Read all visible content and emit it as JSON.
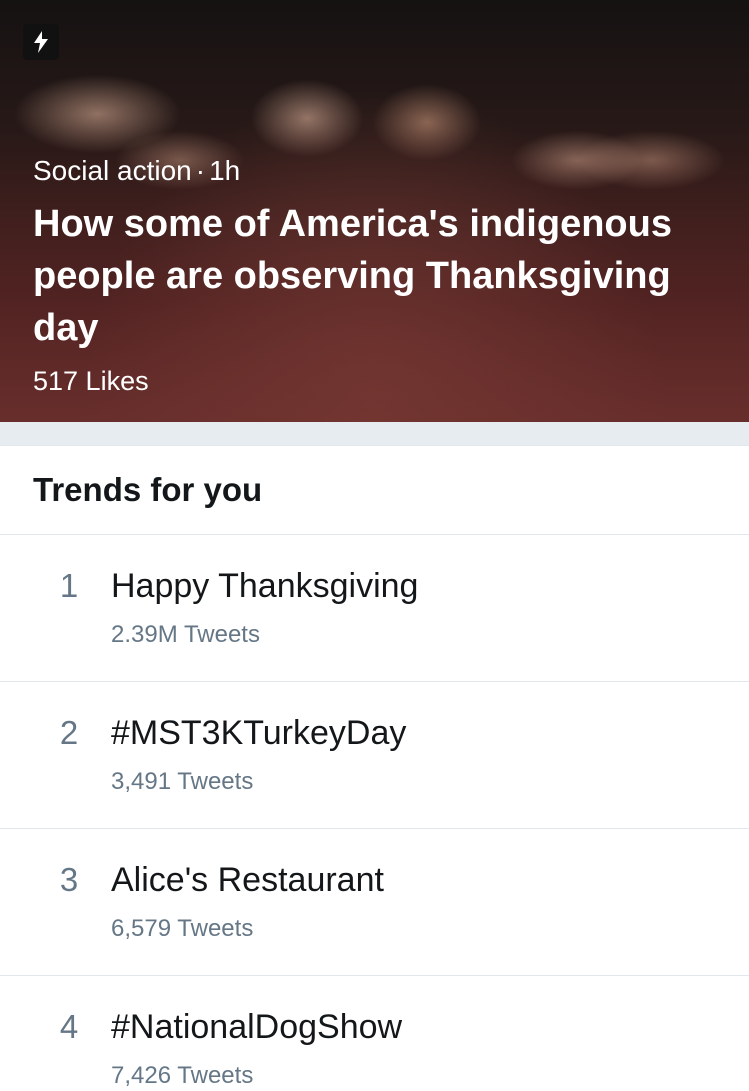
{
  "moment": {
    "icon": "lightning-bolt-icon",
    "category": "Social action",
    "separator": "·",
    "time": "1h",
    "title": "How some of America's indigenous people are observing Thanksgiving day",
    "likes": "517 Likes"
  },
  "trends": {
    "header": "Trends for you",
    "items": [
      {
        "rank": "1",
        "name": "Happy Thanksgiving",
        "count": "2.39M Tweets"
      },
      {
        "rank": "2",
        "name": "#MST3KTurkeyDay",
        "count": "3,491 Tweets"
      },
      {
        "rank": "3",
        "name": "Alice's Restaurant",
        "count": "6,579 Tweets"
      },
      {
        "rank": "4",
        "name": "#NationalDogShow",
        "count": "7,426 Tweets"
      }
    ]
  },
  "colors": {
    "text_primary": "#14171a",
    "text_secondary": "#657786",
    "divider": "#e1e8ed",
    "section_gap": "#e6ecf0"
  }
}
